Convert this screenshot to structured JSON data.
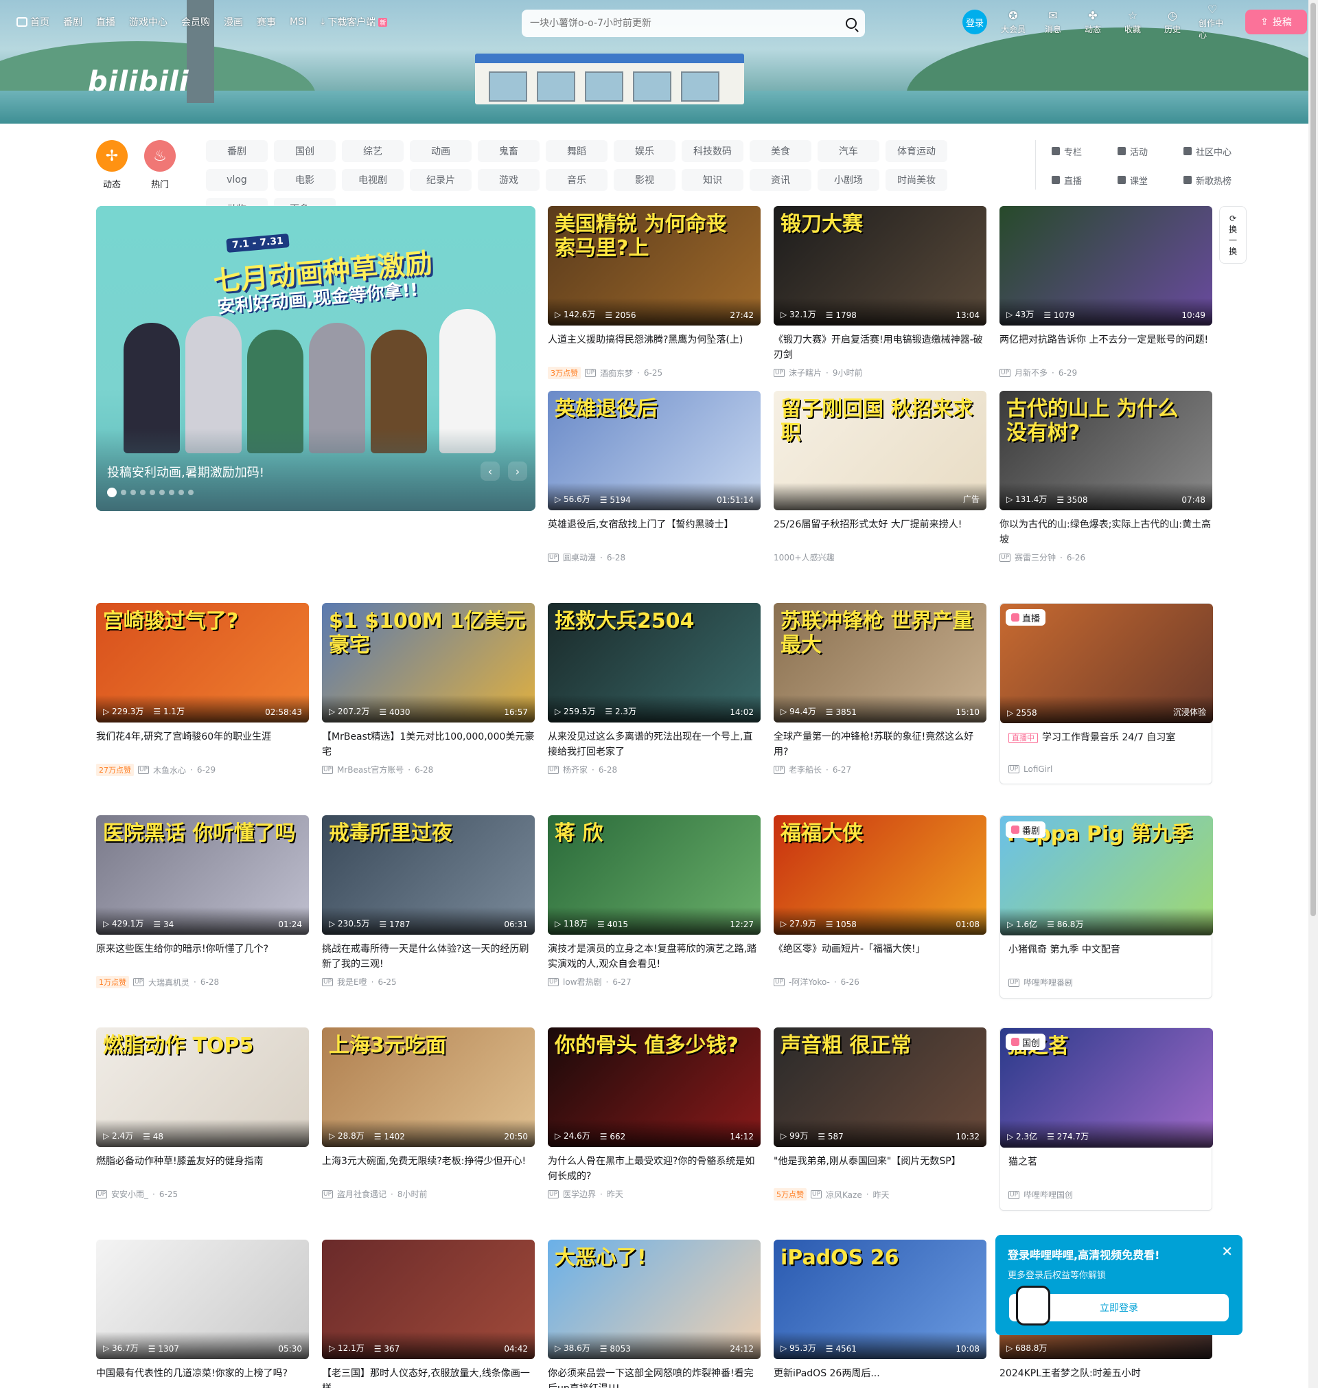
{
  "header": {
    "logo": "bilibili",
    "nav": [
      {
        "label": "首页",
        "icon": "tv-icon"
      },
      {
        "label": "番剧"
      },
      {
        "label": "直播"
      },
      {
        "label": "游戏中心"
      },
      {
        "label": "会员购"
      },
      {
        "label": "漫画"
      },
      {
        "label": "赛事"
      },
      {
        "label": "MSI"
      },
      {
        "label": "下载客户端",
        "icon": "download-icon",
        "badge": "新"
      }
    ],
    "search_placeholder": "一块小薯饼o-o-7小时前更新",
    "login_label": "登录",
    "right_nav": [
      {
        "label": "大会员",
        "icon": "vip-icon"
      },
      {
        "label": "消息",
        "icon": "mail-icon"
      },
      {
        "label": "动态",
        "icon": "activity-icon"
      },
      {
        "label": "收藏",
        "icon": "star-icon"
      },
      {
        "label": "历史",
        "icon": "clock-icon"
      },
      {
        "label": "创作中心",
        "icon": "bulb-icon"
      }
    ],
    "upload_label": "投稿"
  },
  "channels": {
    "dynamic_label": "动态",
    "hot_label": "热门",
    "row1": [
      "番剧",
      "国创",
      "综艺",
      "动画",
      "鬼畜",
      "舞蹈",
      "娱乐",
      "科技数码",
      "美食",
      "汽车",
      "体育运动",
      "vlog"
    ],
    "row2": [
      "电影",
      "电视剧",
      "纪录片",
      "游戏",
      "音乐",
      "影视",
      "知识",
      "资讯",
      "小剧场",
      "时尚美妆",
      "动物",
      "更多"
    ],
    "side": [
      "专栏",
      "活动",
      "社区中心",
      "直播",
      "课堂",
      "新歌热榜"
    ]
  },
  "carousel": {
    "headline": "七月动画种草激励",
    "subline": "安利好动画,现金等你拿!!",
    "date": "7.1 - 7.31",
    "caption": "投稿安利动画,暑期激励加码!",
    "dots": 9,
    "active_dot": 0
  },
  "refresh_label": "换一换",
  "cards": [
    {
      "title": "人道主义援助搞得民怨沸腾?黑鹰为何坠落(上)",
      "thumb_text": "美国精锐 为何命丧 索马里?上",
      "views": "142.6万",
      "danmaku": "2056",
      "duration": "27:42",
      "hot": "3万点赞",
      "author": "酒痴东梦",
      "date": "6-25",
      "colors": [
        "#5a3b1c",
        "#a06a2a"
      ]
    },
    {
      "title": "《锻刀大赛》开启复活赛!用电镐锻造缴械神器-破刃剑",
      "thumb_text": "锻刀大赛",
      "views": "32.1万",
      "danmaku": "1798",
      "duration": "13:04",
      "author": "沫子瞎片",
      "date": "9小时前",
      "colors": [
        "#1c1c1c",
        "#5a4a3a"
      ]
    },
    {
      "title": "两亿把对抗路告诉你 上不去分一定是账号的问题!",
      "thumb_text": "",
      "views": "43万",
      "danmaku": "1079",
      "duration": "10:49",
      "author": "月新不多",
      "date": "6-29",
      "colors": [
        "#274a2a",
        "#6a4aa0"
      ]
    },
    {
      "title": "英雄退役后,女宿敌找上门了【誓约黑骑士】",
      "thumb_text": "英雄退役后",
      "views": "56.6万",
      "danmaku": "5194",
      "duration": "01:51:14",
      "author": "圆桌动漫",
      "date": "6-28",
      "colors": [
        "#6a8ac8",
        "#c8d8f0"
      ]
    },
    {
      "title": "25/26届留子秋招形式太好 大厂提前来捞人!",
      "thumb_text": "留子刚回国 秋招来求职",
      "views": "",
      "danmaku": "",
      "duration": "",
      "ad": "广告",
      "sub": "1000+人感兴趣",
      "colors": [
        "#f6f0e4",
        "#e8dcc4"
      ]
    },
    {
      "title": "你以为古代的山:绿色爆表;实际上古代的山:黄土高坡",
      "thumb_text": "古代的山上 为什么 没有树?",
      "views": "131.4万",
      "danmaku": "3508",
      "duration": "07:48",
      "author": "赛雷三分钟",
      "date": "6-26",
      "colors": [
        "#3a3a3a",
        "#8a8a8a"
      ]
    },
    {
      "title": "我们花4年,研究了宫崎骏60年的职业生涯",
      "thumb_text": "宫崎骏过气了?",
      "views": "229.3万",
      "danmaku": "1.1万",
      "duration": "02:58:43",
      "hot": "27万点赞",
      "author": "木鱼水心",
      "date": "6-29",
      "colors": [
        "#d8501c",
        "#f08030"
      ]
    },
    {
      "title": "【MrBeast精选】1美元对比100,000,000美元豪宅",
      "thumb_text": "$1  $100M  1亿美元豪宅",
      "views": "207.2万",
      "danmaku": "4030",
      "duration": "16:57",
      "author": "MrBeast官方账号",
      "date": "6-28",
      "colors": [
        "#5a7ab0",
        "#e0b040"
      ]
    },
    {
      "title": "从来没见过这么多离谱的死法出现在一个号上,直接给我打回老家了",
      "thumb_text": "拯救大兵2504",
      "views": "259.5万",
      "danmaku": "2.3万",
      "duration": "14:02",
      "author": "杨齐家",
      "date": "6-28",
      "colors": [
        "#1a2a2a",
        "#3a6a6a"
      ]
    },
    {
      "title": "全球产量第一的冲锋枪!苏联的象征!竟然这么好用?",
      "thumb_text": "苏联冲锋枪 世界产量最大",
      "views": "94.4万",
      "danmaku": "3851",
      "duration": "15:10",
      "author": "老李船长",
      "date": "6-27",
      "colors": [
        "#8a7050",
        "#c8b090"
      ]
    },
    {
      "title": "学习工作背景音乐 24/7 自习室",
      "thumb_text": "",
      "views": "2558",
      "danmaku": "",
      "duration": "沉浸体验",
      "tag": "直播",
      "live": "直播中",
      "author": "LofiGirl",
      "date": "",
      "colors": [
        "#c86a30",
        "#6a3a2a"
      ]
    },
    {
      "title": "原来这些医生给你的暗示!你听懂了几个?",
      "thumb_text": "医院黑话 你听懂了吗",
      "views": "429.1万",
      "danmaku": "34",
      "duration": "01:24",
      "hot": "1万点赞",
      "author": "大瑞真机灵",
      "date": "6-28",
      "colors": [
        "#7a7a8a",
        "#c0c0d0"
      ]
    },
    {
      "title": "挑战在戒毒所待一天是什么体验?这一天的经历刷新了我的三观!",
      "thumb_text": "戒毒所里过夜",
      "views": "230.5万",
      "danmaku": "1787",
      "duration": "06:31",
      "author": "我是E噔",
      "date": "6-25",
      "colors": [
        "#3a4a5a",
        "#7a8a9a"
      ]
    },
    {
      "title": "演技才是演员的立身之本!复盘蒋欣的演艺之路,踏实演戏的人,观众自会看见!",
      "thumb_text": "蒋   欣",
      "views": "118万",
      "danmaku": "4015",
      "duration": "12:27",
      "author": "low君热剧",
      "date": "6-27",
      "colors": [
        "#2a6a3a",
        "#6ab06a"
      ]
    },
    {
      "title": "《绝区零》动画短片-「福福大侠!」",
      "thumb_text": "福福大侠",
      "views": "27.9万",
      "danmaku": "1058",
      "duration": "01:08",
      "author": "-阿洋Yoko-",
      "date": "6-26",
      "colors": [
        "#c83010",
        "#f0a020"
      ]
    },
    {
      "title": "小猪佩奇 第九季 中文配音",
      "thumb_text": "Peppa Pig 第九季",
      "views": "1.6亿",
      "danmaku": "86.8万",
      "duration": "",
      "tag": "番剧",
      "author": "哔哩哔哩番剧",
      "date": "",
      "colors": [
        "#6ac0e8",
        "#a0d870"
      ]
    },
    {
      "title": "燃脂必备动作种草!膝盖友好的健身指南",
      "thumb_text": "燃脂动作 TOP5",
      "views": "2.4万",
      "danmaku": "48",
      "duration": "",
      "author": "安安小雨_",
      "date": "6-25",
      "colors": [
        "#f0ece6",
        "#d8d0c4"
      ]
    },
    {
      "title": "上海3元大碗面,免费无限续?老板:挣得少但开心!",
      "thumb_text": "上海3元吃面",
      "views": "28.8万",
      "danmaku": "1402",
      "duration": "20:50",
      "author": "盗月社食遇记",
      "date": "8小时前",
      "colors": [
        "#b08050",
        "#e0c090"
      ]
    },
    {
      "title": "为什么人骨在黑市上最受欢迎?你的骨骼系统是如何长成的?",
      "thumb_text": "你的骨头 值多少钱?",
      "views": "24.6万",
      "danmaku": "662",
      "duration": "14:12",
      "author": "医学边界",
      "date": "昨天",
      "colors": [
        "#1a0a0a",
        "#8a1a1a"
      ]
    },
    {
      "title": "\"他是我弟弟,刚从泰国回来\"【阅片无数SP】",
      "thumb_text": "声音粗 很正常",
      "views": "99万",
      "danmaku": "587",
      "duration": "10:32",
      "hot": "5万点赞",
      "author": "凉风Kaze",
      "date": "昨天",
      "colors": [
        "#2a2a2a",
        "#6a4a3a"
      ]
    },
    {
      "title": "猫之茗",
      "thumb_text": "猫之茗",
      "views": "2.3亿",
      "danmaku": "274.7万",
      "duration": "",
      "tag": "国创",
      "author": "哔哩哔哩国创",
      "date": "",
      "colors": [
        "#2a3a8a",
        "#a06ac8"
      ]
    },
    {
      "title": "中国最有代表性的几道凉菜!你家的上榜了吗?",
      "thumb_text": "",
      "views": "36.7万",
      "danmaku": "1307",
      "duration": "05:30",
      "author": "",
      "date": "",
      "colors": [
        "#f4f4f4",
        "#c8c8c8"
      ]
    },
    {
      "title": "【老三国】那时人仪态好,衣服放量大,线条像画一样",
      "thumb_text": "",
      "views": "12.1万",
      "danmaku": "367",
      "duration": "04:42",
      "author": "",
      "date": "",
      "colors": [
        "#6a2a2a",
        "#a04a3a"
      ]
    },
    {
      "title": "你必须来品尝一下这部全网怒喷的炸裂神番!看完后up直接红温!!!",
      "thumb_text": "大恶心了!",
      "views": "38.6万",
      "danmaku": "8053",
      "duration": "24:12",
      "author": "",
      "date": "",
      "colors": [
        "#6ab0e8",
        "#f0d0b0"
      ]
    },
    {
      "title": "更新iPadOS 26两周后...",
      "thumb_text": "iPadOS 26",
      "views": "95.3万",
      "danmaku": "4561",
      "duration": "10:08",
      "author": "",
      "date": "",
      "colors": [
        "#2a5ab0",
        "#6a9ae0"
      ]
    },
    {
      "title": "2024KPL王者梦之队:时差五小时",
      "thumb_text": "",
      "views": "688.8万",
      "danmaku": "",
      "duration": "",
      "author": "",
      "date": "",
      "colors": [
        "#c86a30",
        "#3a2a2a"
      ]
    }
  ],
  "popup": {
    "title": "登录哔哩哔哩,高清视频免费看!",
    "subtitle": "更多登录后权益等你解锁",
    "button": "立即登录"
  }
}
